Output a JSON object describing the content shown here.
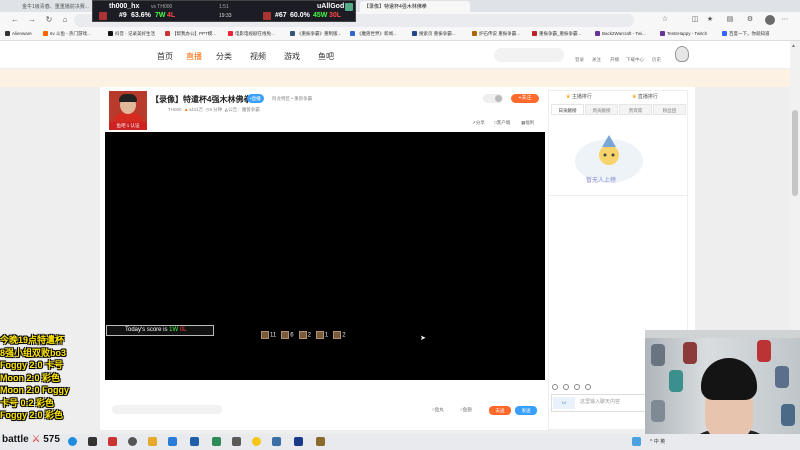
{
  "browser": {
    "tabs": [
      {
        "label": "金牛1级青春、重重播前决赛..."
      },
      {
        "label": "【录像】特遣杯4强木林佛拳"
      }
    ],
    "bookmarks": [
      "Alienware",
      "6v 斗鱼 - 热门游戏...",
      "抖音 - 记录美好生活",
      "【帮我办公】PPT模...",
      "电影电视剧在线免...",
      "《重振争霸》重制版...",
      "《魔兽世界》新闻...",
      "搜索页 重振争霸...",
      "炉石传说 重振争霸...",
      "重振争霸_重振争霸...",
      "Back2Warcraft - Twi...",
      "TestsHappy - Twitch",
      "百度一下，你就知道"
    ]
  },
  "score_overlay": {
    "p1_name": "th000_hx",
    "p1_sub": "vs TH000",
    "p1_rank": "#9",
    "p1_pct": "63.6%",
    "p1_w": "7W",
    "p1_l": "4L",
    "clock": "1:51",
    "clock2": "19:33",
    "p2_name": "uAllGod",
    "p2_rank": "#67",
    "p2_pct": "60.0%",
    "p2_w": "45W",
    "p2_l": "30L"
  },
  "site_nav": {
    "items": [
      "首页",
      "直播",
      "分类",
      "视频",
      "游戏",
      "鱼吧"
    ],
    "active_index": 1,
    "user_links": [
      "登录",
      "关注",
      "开播",
      "下载中心",
      "历史"
    ]
  },
  "room": {
    "host_tag": "鱼吧 1 认证",
    "title": "【录像】特遣杯4强木林佛拳",
    "badge": "•直播",
    "tag": "阿龙特区 • 重新争霸",
    "meta": [
      "TH000",
      "4431万",
      "5 分钟",
      "公告：魔兽争霸"
    ],
    "follow": "关注",
    "links": [
      "分享",
      "客户端",
      "福利"
    ]
  },
  "player": {
    "score_prefix": "Today's score is ",
    "score_w": "1W",
    "score_l": "0L",
    "resources": [
      "11",
      "6",
      "2",
      "1",
      "2"
    ]
  },
  "under_player": {
    "controls": [
      "鱼丸",
      "鱼翅"
    ],
    "gift": "去送",
    "send": "发送"
  },
  "sidebar": {
    "rank_tabs": [
      "主播排行",
      "直播排行"
    ],
    "sub_tabs": [
      "日贡献榜",
      "周贡献榜",
      "贵宾席",
      "粉丝团"
    ],
    "empty_text": "暂无人上榜",
    "chat_level": "LV",
    "chat_placeholder": "这里输入聊天内容"
  },
  "stream_text": [
    "今晚19点特遣杯",
    "8强小组双败bo3",
    "Foggy 2:0 卡号",
    "Moon  2:0 彩色",
    "Moon 2:0 Foggy",
    "卡号    0:2 彩色",
    "Foggy 2:0 彩色"
  ],
  "taskbar": {
    "battle_label": "battle",
    "battle_count": "575",
    "tray": "^ 中 英"
  },
  "colors": {
    "accent": "#ff6a2c",
    "blue": "#3aa0ff",
    "overlay_yellow": "#ffe600",
    "win_green": "#44ff44",
    "loss_red": "#ff4444"
  }
}
